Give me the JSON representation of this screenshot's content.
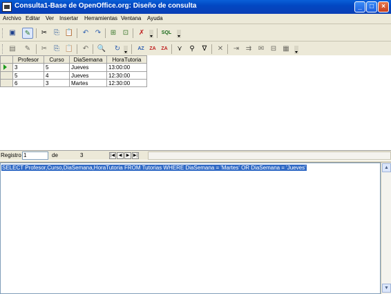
{
  "window": {
    "title": "Consulta1-Base de OpenOffice.org: Diseño de consulta",
    "minimize": "_",
    "maximize": "□",
    "close": "×"
  },
  "menu": [
    "Archivo",
    "Editar",
    "Ver",
    "Insertar",
    "Herramientas",
    "Ventana",
    "Ayuda"
  ],
  "colors": {
    "title_bar": "#0a3fb5",
    "selection": "#316ac5",
    "row_indicator": "#1c9a1c"
  },
  "toolbar1": {
    "icons": [
      "save-icon",
      "edit-mode-icon",
      "cut-icon",
      "copy-icon",
      "paste-icon",
      "undo-icon",
      "redo-icon",
      "add-tables-icon",
      "functions-icon",
      "clear-query-icon",
      "sql-view-icon"
    ],
    "glyphs": [
      "▣",
      "✎",
      "✂",
      "⎘",
      "📋",
      "↶",
      "↷",
      "⊞",
      "⊡",
      "✗",
      "SQL"
    ]
  },
  "toolbar2": {
    "icons": [
      "save-record-icon",
      "edit-data-icon",
      "cut-icon",
      "copy-icon",
      "paste-icon",
      "undo-icon",
      "find-icon",
      "refresh-icon",
      "sort-ascending-icon",
      "sort-descending-icon",
      "auto-filter-icon",
      "standard-filter-icon",
      "remove-filter-icon",
      "clear-filter-icon",
      "data-to-text-icon",
      "data-to-fields-icon",
      "mail-merge-icon",
      "data-source-icon",
      "explorer-icon"
    ],
    "glyphs": [
      "▤",
      "✎",
      "✂",
      "⎘",
      "📋",
      "↶",
      "🔍",
      "↻",
      "AZ",
      "ZA",
      "⋎",
      "⚲",
      "∇",
      "✕",
      "⇥",
      "⇉",
      "✉",
      "⊟",
      "▦"
    ]
  },
  "grid": {
    "columns": [
      "Profesor",
      "Curso",
      "DiaSemana",
      "HoraTutoria"
    ],
    "rows": [
      [
        "3",
        "5",
        "Jueves",
        "13:00:00"
      ],
      [
        "5",
        "4",
        "Jueves",
        "12:30:00"
      ],
      [
        "6",
        "3",
        "Martes",
        "12:30:00"
      ]
    ]
  },
  "navigation": {
    "record_label": "Registro",
    "current": "1",
    "of_label": "de",
    "total": "3",
    "buttons": [
      "|◀",
      "◀",
      "▶",
      "▶|"
    ]
  },
  "sql": "SELECT Profesor,Curso,DiaSemana,HoraTutoria  FROM Tutorias WHERE DiaSemana = 'Martes' OR DiaSemana = 'Jueves'",
  "scrollbar": {
    "up": "▲",
    "down": "▼"
  }
}
